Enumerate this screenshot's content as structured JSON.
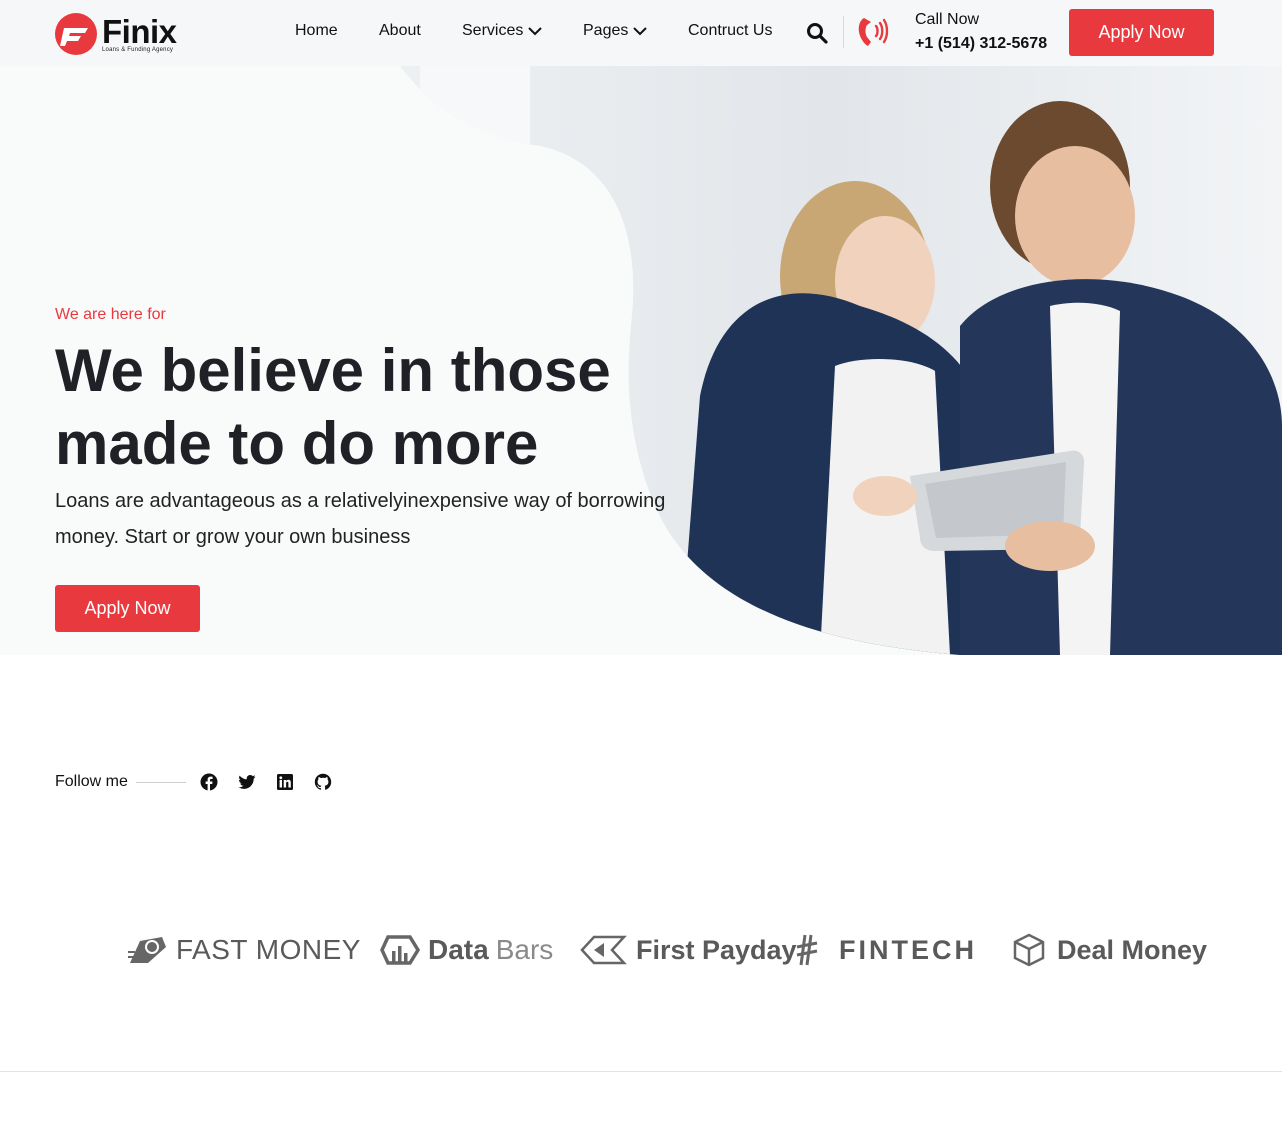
{
  "brand": {
    "name": "Finix",
    "tagline": "Loans & Funding Agency",
    "accent_color": "#e8393f"
  },
  "nav": {
    "items": [
      {
        "label": "Home",
        "has_dropdown": false
      },
      {
        "label": "About",
        "has_dropdown": false
      },
      {
        "label": "Services",
        "has_dropdown": true
      },
      {
        "label": "Pages",
        "has_dropdown": true
      },
      {
        "label": "Contruct Us",
        "has_dropdown": false
      }
    ]
  },
  "header": {
    "call_label": "Call Now",
    "call_number": "+1 (514) 312-5678",
    "apply_label": "Apply Now"
  },
  "hero": {
    "eyebrow": "We are here for",
    "title": "We believe in those made to do more",
    "description": "Loans are advantageous as a relativelyinexpensive way of borrowing money. Start or grow your own business",
    "apply_label": "Apply Now"
  },
  "follow": {
    "label": "Follow me",
    "icons": [
      "facebook-icon",
      "twitter-icon",
      "linkedin-icon",
      "github-icon"
    ]
  },
  "partners": {
    "items": [
      {
        "name": "FAST MONEY"
      },
      {
        "name": "Data",
        "name_light": "Bars"
      },
      {
        "name": "First Payday"
      },
      {
        "name": "FINTECH"
      },
      {
        "name": "Deal Money"
      }
    ]
  }
}
